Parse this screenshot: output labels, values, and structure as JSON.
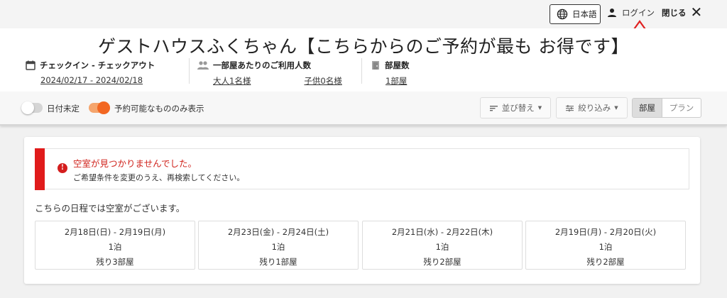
{
  "topbar": {
    "language": "日本語",
    "login": "ログイン",
    "close": "閉じる",
    "close_glyph": "✕"
  },
  "header": {
    "title": "ゲストハウスふくちゃん【こちらからのご予約が最も お得です】",
    "checkin": {
      "label": "チェックイン - チェックアウト",
      "value": "2024/02/17 - 2024/02/18"
    },
    "guests": {
      "label": "一部屋あたりのご利用人数",
      "adults": "大人1名様",
      "children": "子供0名様"
    },
    "rooms": {
      "label": "部屋数",
      "value": "1部屋"
    }
  },
  "filters": {
    "date_undecided": "日付未定",
    "available_only": "予約可能なもののみ表示",
    "date_undecided_on": false,
    "available_only_on": true,
    "sort": "並び替え",
    "filter": "絞り込み",
    "view_tabs": [
      "部屋",
      "プラン"
    ],
    "view_selected": "部屋"
  },
  "alert": {
    "icon": "!",
    "title": "空室が見つかりませんでした。",
    "message": "ご希望条件を変更のうえ、再検索してください。"
  },
  "availability": {
    "heading": "こちらの日程では空室がございます。",
    "options": [
      {
        "dates": "2月18日(日) - 2月19日(月)",
        "nights": "1泊",
        "remaining": "残り3部屋"
      },
      {
        "dates": "2月23日(金) - 2月24日(土)",
        "nights": "1泊",
        "remaining": "残り1部屋"
      },
      {
        "dates": "2月21日(水) - 2月22日(木)",
        "nights": "1泊",
        "remaining": "残り2部屋"
      },
      {
        "dates": "2月19日(月) - 2月20日(火)",
        "nights": "1泊",
        "remaining": "残り2部屋"
      }
    ]
  },
  "colors": {
    "accent": "#f26722",
    "alert_red": "#e01b1b",
    "annotation_arrow": "#e02020"
  },
  "icons": [
    "globe-icon",
    "person-icon",
    "close-icon",
    "calendar-icon",
    "people-icon",
    "door-icon",
    "sort-icon",
    "filter-icon",
    "error-icon",
    "up-arrow-icon"
  ]
}
